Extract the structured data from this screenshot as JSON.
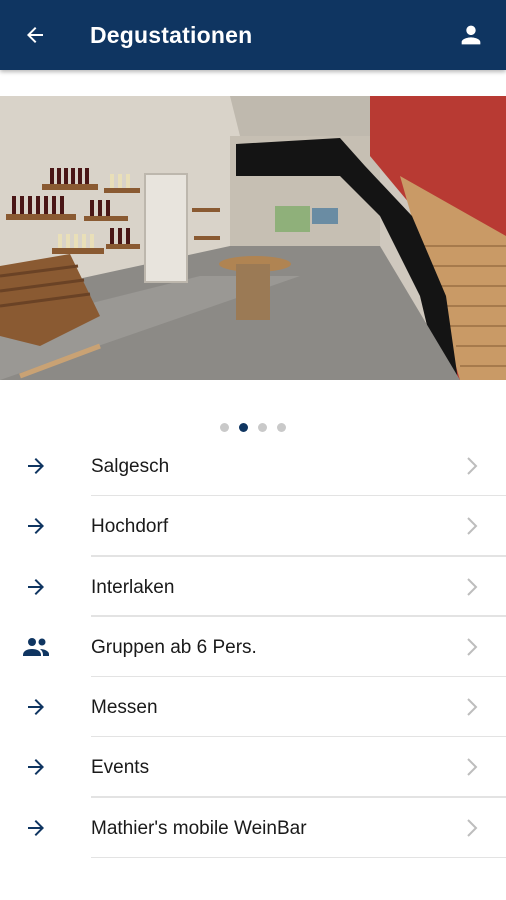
{
  "appbar": {
    "title": "Degustationen",
    "back_icon": "arrow-left-icon",
    "account_icon": "person-icon",
    "background": "#0f3561"
  },
  "carousel": {
    "image_description": "wine tasting room interior",
    "page_count": 4,
    "active_page": 2
  },
  "menu": {
    "items": [
      {
        "label": "Salgesch",
        "icon": "arrow-right-icon"
      },
      {
        "label": "Hochdorf",
        "icon": "arrow-right-icon"
      },
      {
        "label": "Interlaken",
        "icon": "arrow-right-icon"
      },
      {
        "label": "Gruppen ab 6 Pers.",
        "icon": "group-icon"
      },
      {
        "label": "Messen",
        "icon": "arrow-right-icon"
      },
      {
        "label": "Events",
        "icon": "arrow-right-icon"
      },
      {
        "label": "Mathier's mobile WeinBar",
        "icon": "arrow-right-icon"
      }
    ]
  },
  "colors": {
    "accent": "#0f3561",
    "chevron": "#bdbdbd",
    "divider": "#e3e3e3"
  }
}
